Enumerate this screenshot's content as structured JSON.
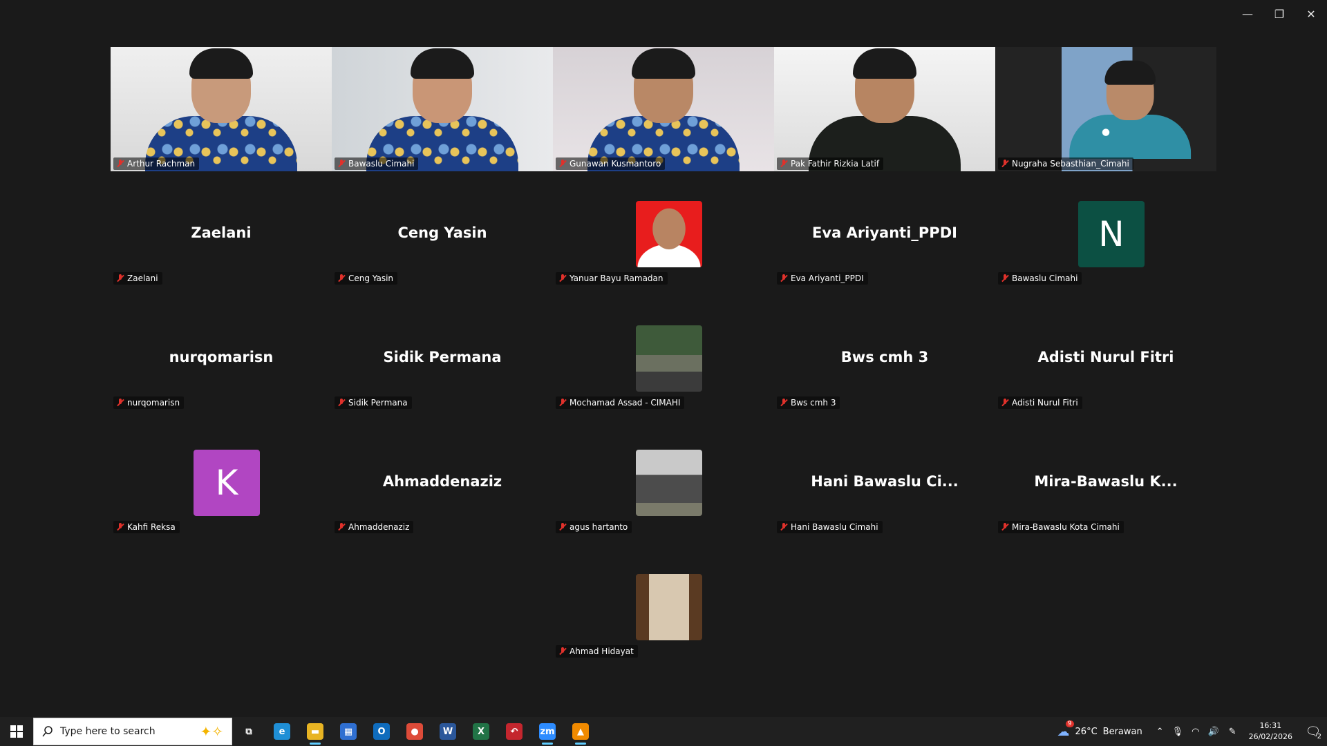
{
  "window": {
    "controls": [
      "—",
      "❐",
      "✕"
    ]
  },
  "video_tiles": [
    {
      "name": "Arthur Rachman",
      "skin": "#c89a7b",
      "shirt": "batik"
    },
    {
      "name": "Bawaslu Cimahi",
      "skin": "#c99676",
      "shirt": "batik"
    },
    {
      "name": "Gunawan Kusmantoro",
      "skin": "#b98866",
      "shirt": "batik"
    },
    {
      "name": "Pak Fathir Rizkia Latif",
      "skin": "#b78562",
      "shirt": "dark",
      "active": true
    },
    {
      "name": "Nugraha Sebasthian_Cimahi",
      "skin": "#b98a69",
      "shirt": "batik-teal"
    }
  ],
  "grid_tiles": [
    {
      "display": "Zaelani",
      "tag": "Zaelani"
    },
    {
      "display": "Ceng Yasin",
      "tag": "Ceng Yasin"
    },
    {
      "display": "",
      "tag": "Yanuar Bayu Ramadan",
      "avatar": "photo-red"
    },
    {
      "display": "Eva Ariyanti_PPDI",
      "tag": "Eva Ariyanti_PPDI"
    },
    {
      "display": "N",
      "tag": "Bawaslu Cimahi",
      "avatar": "letter",
      "color": "#0c5043"
    },
    {
      "display": "nurqomarisn",
      "tag": "nurqomarisn"
    },
    {
      "display": "Sidik Permana",
      "tag": "Sidik Permana"
    },
    {
      "display": "",
      "tag": "Mochamad Assad - CIMAHI",
      "avatar": "photo-moto"
    },
    {
      "display": "Bws cmh 3",
      "tag": "Bws cmh 3"
    },
    {
      "display": "Adisti Nurul Fitri",
      "tag": "Adisti Nurul Fitri"
    },
    {
      "display": "K",
      "tag": "Kahfi Reksa",
      "avatar": "letter",
      "color": "#b146c2"
    },
    {
      "display": "Ahmaddenaziz",
      "tag": "Ahmaddenaziz"
    },
    {
      "display": "",
      "tag": "agus hartanto",
      "avatar": "photo-group"
    },
    {
      "display": "Hani Bawaslu Ci...",
      "tag": "Hani Bawaslu Cimahi"
    },
    {
      "display": "Mira-Bawaslu K...",
      "tag": "Mira-Bawaslu Kota Cimahi"
    },
    {
      "display": "",
      "tag": "Ahmad Hidayat",
      "avatar": "photo-shelf"
    }
  ],
  "taskbar": {
    "search_placeholder": "Type here to search",
    "apps": [
      {
        "name": "task-view",
        "glyph": "⧉",
        "color": "transparent"
      },
      {
        "name": "edge",
        "glyph": "e",
        "color": "#1f8fd6"
      },
      {
        "name": "file-explorer",
        "glyph": "▬",
        "color": "#e8b423",
        "running": true
      },
      {
        "name": "store",
        "glyph": "▦",
        "color": "#2f6fd1"
      },
      {
        "name": "outlook",
        "glyph": "O",
        "color": "#0f6cbd"
      },
      {
        "name": "chrome",
        "glyph": "●",
        "color": "#dd4b39"
      },
      {
        "name": "word",
        "glyph": "W",
        "color": "#2b579a"
      },
      {
        "name": "excel",
        "glyph": "X",
        "color": "#217346"
      },
      {
        "name": "undo-app",
        "glyph": "↶",
        "color": "#c4262e"
      },
      {
        "name": "zoom",
        "glyph": "zm",
        "color": "#2d8cff",
        "running": true
      },
      {
        "name": "vlc",
        "glyph": "▲",
        "color": "#f08a00",
        "running": true
      }
    ],
    "weather": {
      "temp": "26°C",
      "condition": "Berawan",
      "badge": "9"
    },
    "time": "16:31",
    "date": "26/02/2026",
    "notification_count": "2"
  }
}
